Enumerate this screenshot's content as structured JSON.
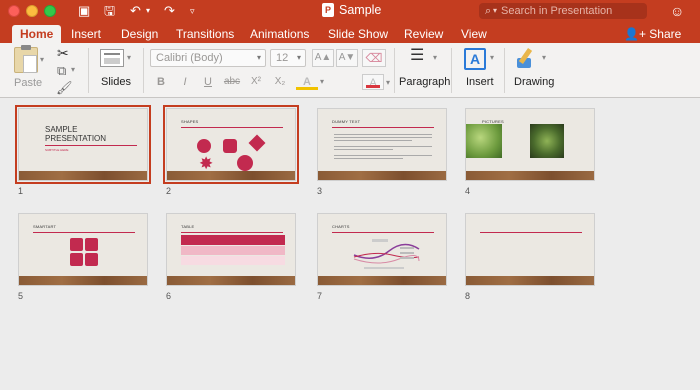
{
  "window": {
    "doc_title": "Sample",
    "doc_badge": "P",
    "search_placeholder": "Search in Presentation"
  },
  "tabs": [
    {
      "label": "Home",
      "active": true
    },
    {
      "label": "Insert"
    },
    {
      "label": "Design"
    },
    {
      "label": "Transitions"
    },
    {
      "label": "Animations"
    },
    {
      "label": "Slide Show"
    },
    {
      "label": "Review"
    },
    {
      "label": "View"
    }
  ],
  "share_label": "Share",
  "ribbon": {
    "paste_label": "Paste",
    "slides_label": "Slides",
    "font_name": "Calibri (Body)",
    "font_size": "12",
    "bold": "B",
    "italic": "I",
    "underline": "U",
    "strike": "abc",
    "superscript": "X²",
    "subscript": "X₂",
    "grow_font": "A▲",
    "shrink_font": "A▼",
    "font_color": "A",
    "highlight": "A",
    "paragraph_label": "Paragraph",
    "insert_label": "Insert",
    "drawing_label": "Drawing"
  },
  "slides": [
    {
      "num": "1",
      "title": "SAMPLE PRESENTATION",
      "subtitle": "SUBTITLE HERE",
      "selected": true
    },
    {
      "num": "2",
      "title": "SHAPES",
      "selected": true
    },
    {
      "num": "3",
      "title": "DUMMY TEXT"
    },
    {
      "num": "4",
      "title": "PICTURES"
    },
    {
      "num": "5",
      "title": "SMARTART"
    },
    {
      "num": "6",
      "title": "TABLE"
    },
    {
      "num": "7",
      "title": "CHARTS"
    },
    {
      "num": "8",
      "title": ""
    }
  ],
  "colors": {
    "accent": "#c43d20",
    "slide_accent": "#c22a4f"
  }
}
